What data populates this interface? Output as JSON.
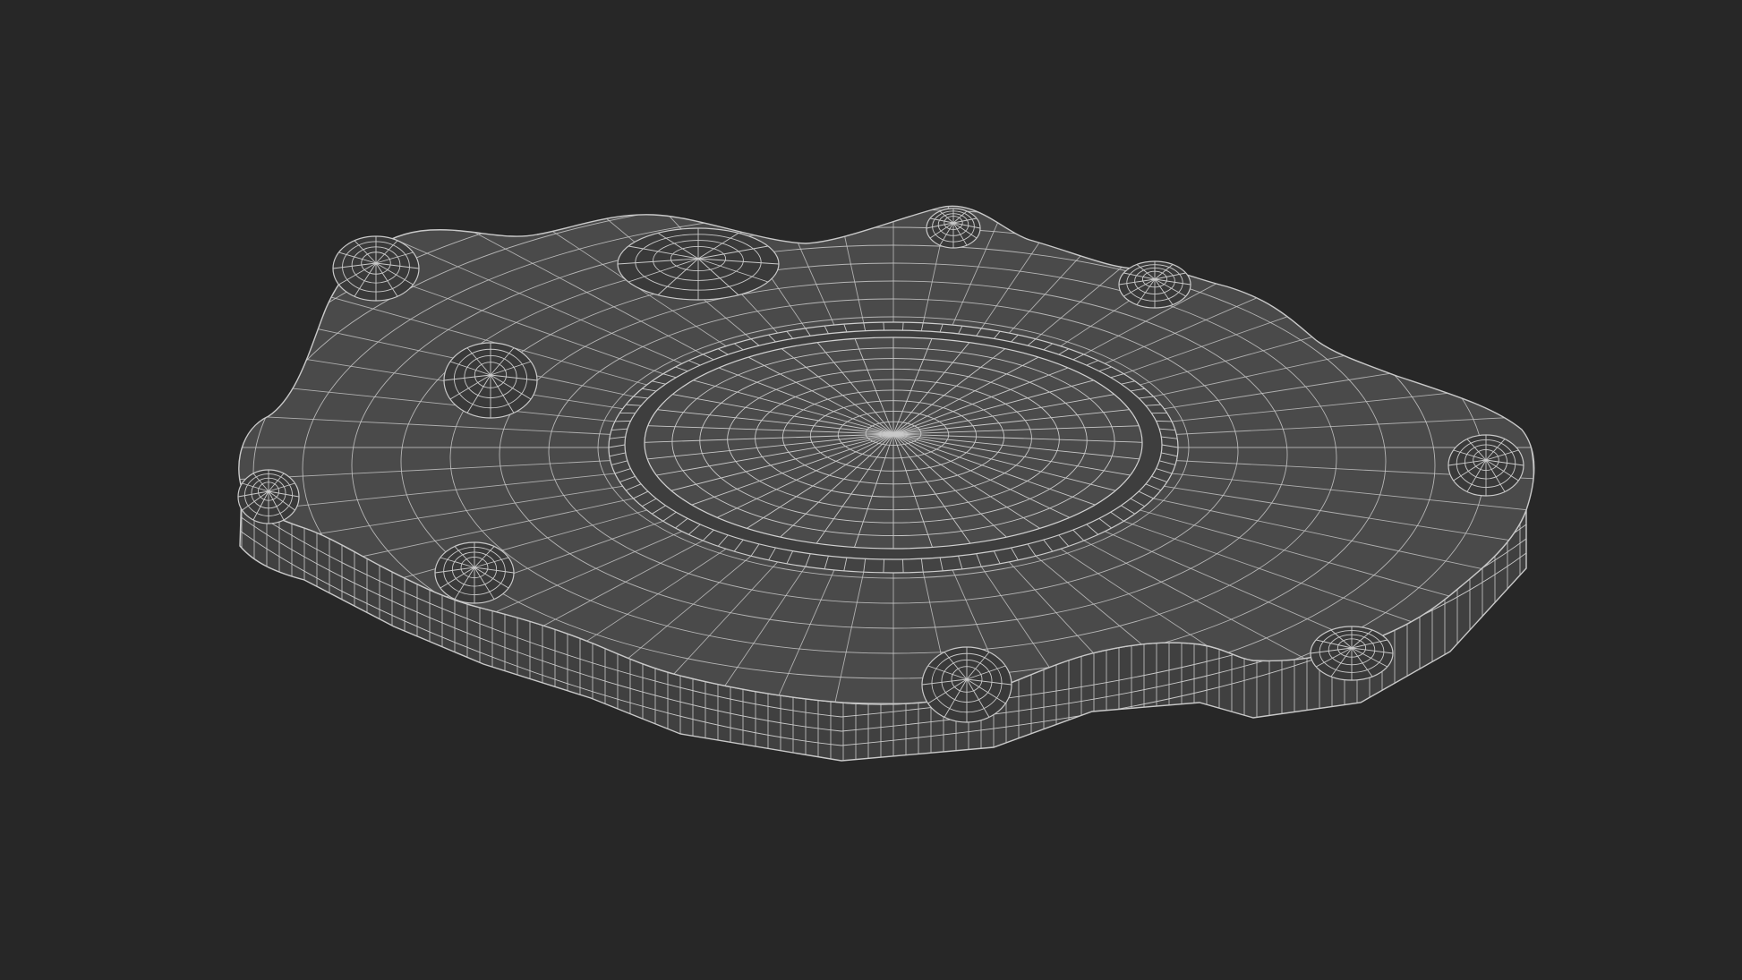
{
  "viewport": {
    "background": "#272727",
    "model_fill": "#4a4a4a",
    "model_fill_dark": "#3a3a3a",
    "model_fill_side": "#404040",
    "wire_color": "#c9c9c9",
    "subject": "wireframe-render"
  }
}
